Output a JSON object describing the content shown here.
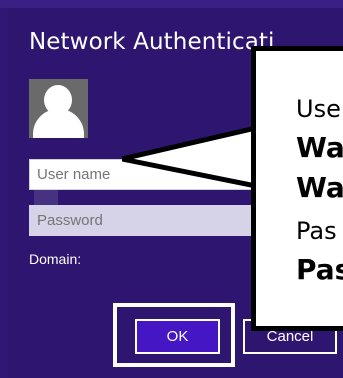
{
  "dialog": {
    "title": "Network Authenticati"
  },
  "fields": {
    "username_placeholder": "User name",
    "password_placeholder": "Password",
    "domain_label": "Domain:"
  },
  "buttons": {
    "ok": "OK",
    "cancel_partial": "Cancel"
  },
  "callout": {
    "line1": "Use",
    "line2": "Wa",
    "line3": "Wa",
    "line4": "Pas",
    "line5": "Pas"
  },
  "colors": {
    "background": "#2e1670",
    "accent": "#4516c4",
    "text": "#ffffff",
    "callout_bg": "#ffffff",
    "callout_border": "#000000"
  },
  "icons": {
    "avatar": "user-avatar-icon"
  }
}
